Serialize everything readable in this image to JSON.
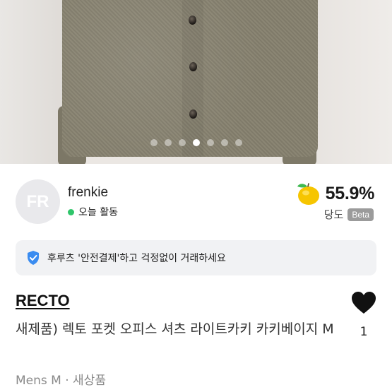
{
  "gallery": {
    "dot_count": 7,
    "active_index": 3
  },
  "seller": {
    "avatar_initials": "FR",
    "name": "frenkie",
    "status": "오늘 활동",
    "rating_value": "55.9%",
    "rating_label": "당도",
    "rating_badge": "Beta",
    "status_color": "#2fc56a"
  },
  "banner": {
    "text": "후루츠 '안전결제'하고 걱정없이 거래하세요",
    "icon": "shield-check-icon",
    "icon_color": "#3a8cf0"
  },
  "product": {
    "brand": "RECTO",
    "title": "새제품) 렉토 포켓 오피스 셔츠 라이트카키 카키베이지 M",
    "meta": "Mens M · 새상품",
    "like_count": "1"
  }
}
